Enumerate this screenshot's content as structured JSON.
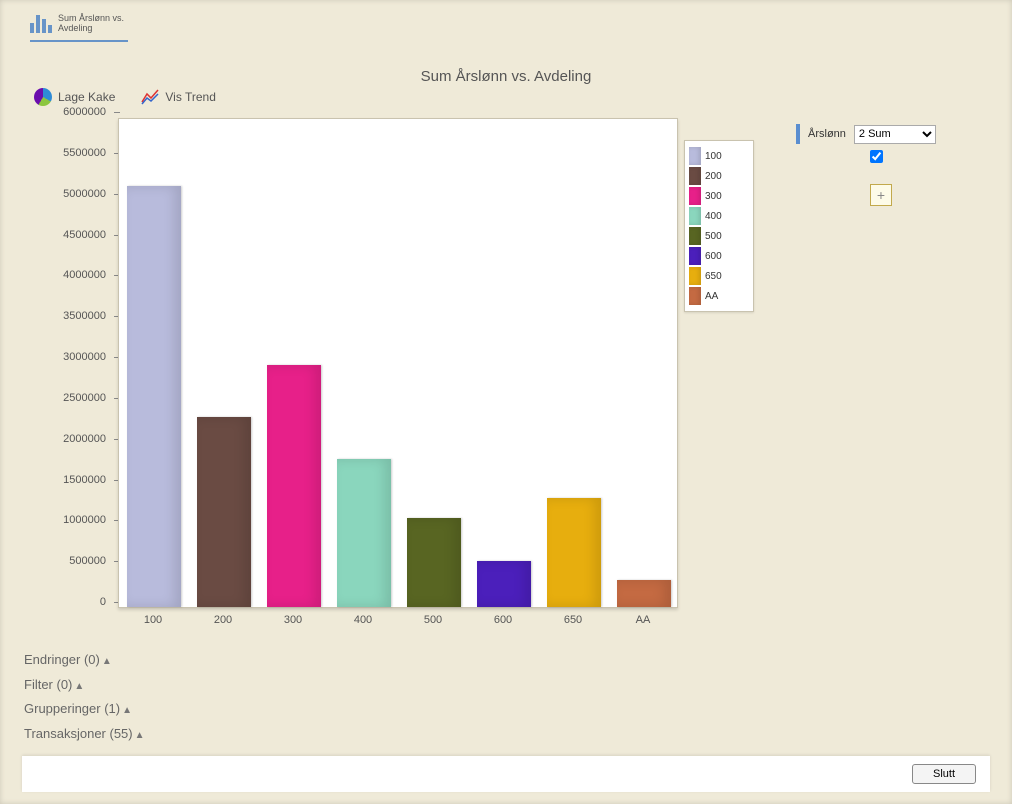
{
  "tab": {
    "label_line1": "Sum Årslønn vs.",
    "label_line2": "Avdeling"
  },
  "page_title": "Sum Årslønn vs. Avdeling",
  "toolbar": {
    "pie_label": "Lage Kake",
    "trend_label": "Vis Trend"
  },
  "side": {
    "field_label": "Årslønn",
    "select_value": "2 Sum",
    "select_options": [
      "2 Sum"
    ],
    "checkbox_checked": true,
    "add_symbol": "+"
  },
  "accordions": [
    {
      "label": "Endringer",
      "count": 0
    },
    {
      "label": "Filter",
      "count": 0
    },
    {
      "label": "Grupperinger",
      "count": 1
    },
    {
      "label": "Transaksjoner",
      "count": 55
    }
  ],
  "footer": {
    "close_label": "Slutt"
  },
  "chart_data": {
    "type": "bar",
    "title": "Sum Årslønn vs. Avdeling",
    "xlabel": "",
    "ylabel": "",
    "ylim": [
      0,
      6000000
    ],
    "y_ticks": [
      0,
      500000,
      1000000,
      1500000,
      2000000,
      2500000,
      3000000,
      3500000,
      4000000,
      4500000,
      5000000,
      5500000,
      6000000
    ],
    "categories": [
      "100",
      "200",
      "300",
      "400",
      "500",
      "600",
      "650",
      "AA"
    ],
    "values": [
      5150000,
      2330000,
      2960000,
      1810000,
      1090000,
      560000,
      1330000,
      330000
    ],
    "colors": [
      "#b8bbdc",
      "#6a4b43",
      "#e72089",
      "#8ad6bd",
      "#586522",
      "#4b1fbb",
      "#e7ae0e",
      "#c46a42"
    ]
  }
}
